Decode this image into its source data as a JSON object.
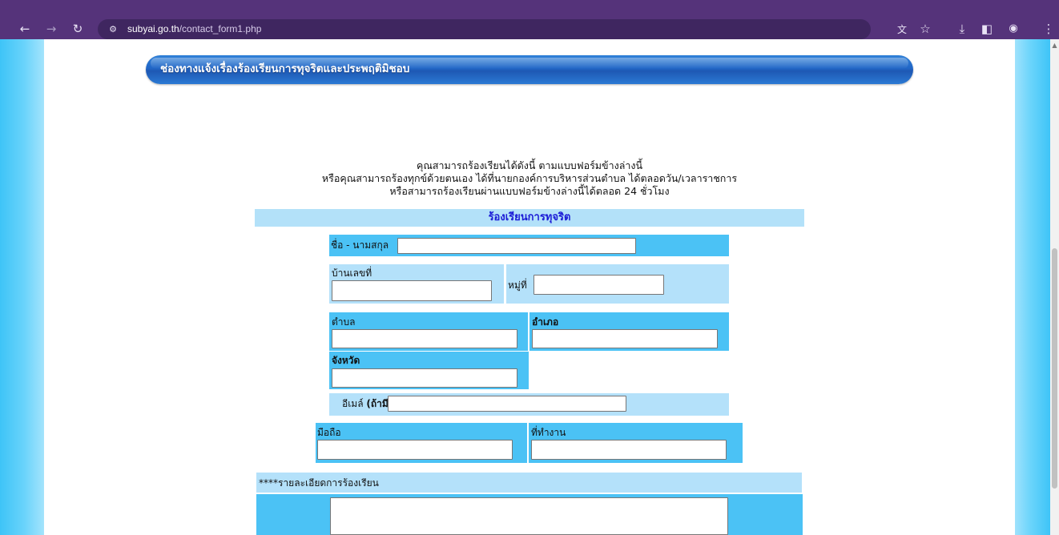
{
  "browser": {
    "url_host": "subyai.go.th",
    "url_path": "/contact_form1.php",
    "icons": [
      "back-arrow-icon",
      "forward-arrow-icon",
      "reload-icon",
      "site-info-icon",
      "translate-icon",
      "star-icon",
      "download-icon",
      "sidepanel-icon",
      "profile-icon",
      "menu-icon"
    ]
  },
  "page": {
    "banner_title": "ช่องทางแจ้งเรื่องร้องเรียนการทุจริตและประพฤติมิชอบ",
    "intro_lines": [
      "คุณสามารถร้องเรียนได้ดังนี้ ตามแบบฟอร์มข้างล่างนี้",
      "หรือคุณสามารถร้องทุกข์ด้วยตนเอง ได้ที่นายกองค์การบริหารส่วนตำบล ได้ตลอดวัน/เวลาราชการ",
      "หรือสามารถร้องเรียนผ่านแบบฟอร์มข้างล่างนี้ได้ตลอด 24 ชั่วโมง"
    ]
  },
  "form": {
    "heading": "ร้องเรียนการทุจริต",
    "name_label": "ชื่อ - นามสกุล",
    "house_no_label": "บ้านเลขที่",
    "moo_label": "หมู่ที่",
    "tambon_label": "ตำบล",
    "amphoe_label": "อำเภอ",
    "province_label": "จังหวัด",
    "email_label": "อีเมล์",
    "email_optional": "(ถ้ามี)",
    "mobile_label": "มือถือ",
    "office_label": "ที่ทำงาน",
    "detail_label": "****รายละเอียดการร้องเรียน"
  }
}
